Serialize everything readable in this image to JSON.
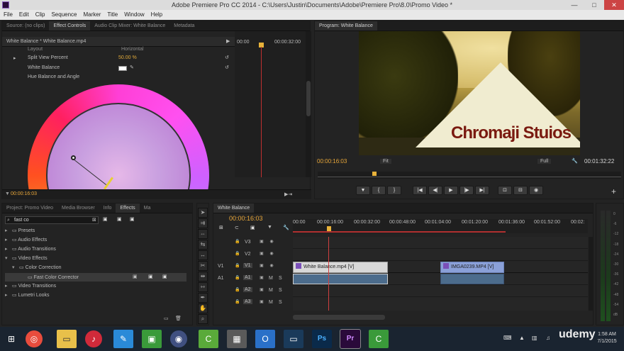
{
  "window": {
    "title": "Adobe Premiere Pro CC 2014 - C:\\Users\\Justin\\Documents\\Adobe\\Premiere Pro\\8.0\\Promo Video *",
    "buttons": [
      "—",
      "□",
      "✕"
    ]
  },
  "menu": [
    "File",
    "Edit",
    "Clip",
    "Sequence",
    "Marker",
    "Title",
    "Window",
    "Help"
  ],
  "effect_controls": {
    "tabs": [
      "Source: (no clips)",
      "Effect Controls",
      "Audio Clip Mixer: White Balance",
      "Metadata"
    ],
    "active_tab": "Effect Controls",
    "clip_header": "White Balance * White Balance.mp4",
    "mini_time_start": "00:00",
    "mini_time_end": "00:00:32:00",
    "layout_label": "Layout",
    "layout_value": "Horizontal",
    "split_label": "Split View Percent",
    "split_value": "50.00 %",
    "wb_label": "White Balance",
    "hue_label": "Hue Balance and Angle",
    "timecode": "00:00:16:03"
  },
  "program": {
    "tab": "Program: White Balance",
    "timecode_left": "00:00:16:03",
    "fit": "Fit",
    "quality": "Full",
    "timecode_right": "00:01:32:22",
    "watermark": "Chromaji Stuios",
    "playhead_fraction": 0.18,
    "transport": [
      "▼",
      "{",
      "}",
      "|◀",
      "◀|",
      "▶",
      "|▶",
      "▶|",
      "⊡",
      "⊟",
      "◉"
    ]
  },
  "project": {
    "tabs": [
      "Project: Promo Video",
      "Media Browser",
      "Info",
      "Effects",
      "Ma"
    ],
    "active_tab": "Effects",
    "search_value": "fast co",
    "tree": [
      {
        "label": "Presets",
        "level": 0
      },
      {
        "label": "Audio Effects",
        "level": 0
      },
      {
        "label": "Audio Transitions",
        "level": 0
      },
      {
        "label": "Video Effects",
        "level": 0
      },
      {
        "label": "Color Correction",
        "level": 1
      },
      {
        "label": "Fast Color Corrector",
        "level": 2
      },
      {
        "label": "Video Transitions",
        "level": 0
      },
      {
        "label": "Lumetri Looks",
        "level": 0
      }
    ]
  },
  "timeline": {
    "tab": "White Balance",
    "timecode": "00:00:16:03",
    "ruler": [
      "00:00",
      "00:00:16:00",
      "00:00:32:00",
      "00:00:48:00",
      "00:01:04:00",
      "00:01:20:00",
      "00:01:36:00",
      "00:01:52:00",
      "00:02:"
    ],
    "tracks": [
      {
        "name": "V3",
        "target": ""
      },
      {
        "name": "V2",
        "target": ""
      },
      {
        "name": "V1",
        "target": "V1"
      },
      {
        "name": "A1",
        "target": "A1"
      },
      {
        "name": "A2",
        "target": ""
      },
      {
        "name": "A3",
        "target": ""
      }
    ],
    "clip1": "White Balance.mp4 [V]",
    "clip2": "IMGA0239.MP4 [V]",
    "audio_meter_labels": [
      "0",
      "-6",
      "-12",
      "-18",
      "-24",
      "-30",
      "-36",
      "-42",
      "-48",
      "-54",
      "dB"
    ]
  },
  "taskbar": {
    "time": "1:58 AM",
    "date": "7/1/2015",
    "brand": "udemy"
  }
}
